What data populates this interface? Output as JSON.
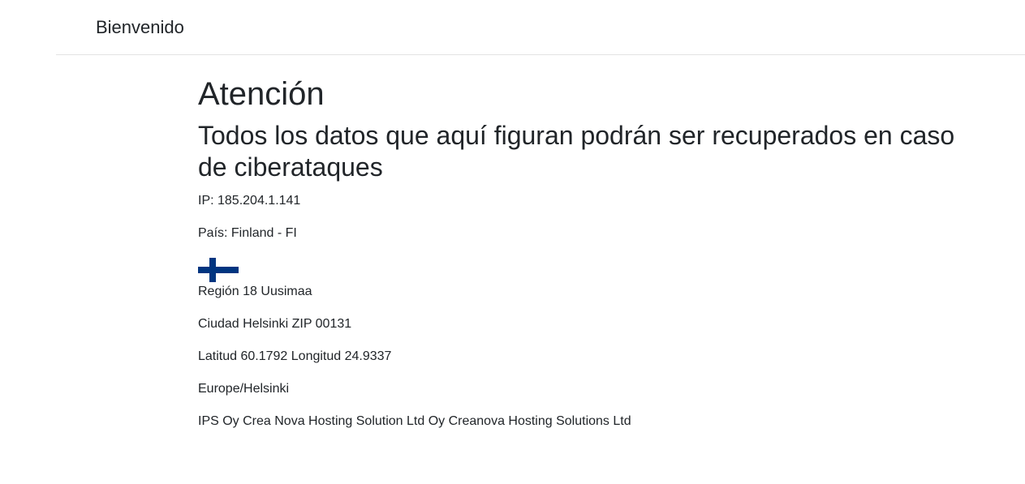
{
  "header": {
    "brand": "Bienvenido"
  },
  "main": {
    "title": "Atención",
    "subtitle": "Todos los datos que aquí figuran podrán ser recuperados en caso de ciberataques",
    "ip": "IP: 185.204.1.141",
    "country": "País: Finland - FI",
    "flag_icon": "finland-flag-icon",
    "region": "Región 18 Uusimaa",
    "city": "Ciudad Helsinki ZIP 00131",
    "coordinates": "Latitud 60.1792 Longitud 24.9337",
    "timezone": "Europe/Helsinki",
    "isp": "IPS Oy Crea Nova Hosting Solution Ltd Oy Creanova Hosting Solutions Ltd"
  },
  "colors": {
    "flag_blue": "#003580",
    "flag_white": "#ffffff",
    "text": "#212529",
    "divider": "#e3e3e3"
  }
}
